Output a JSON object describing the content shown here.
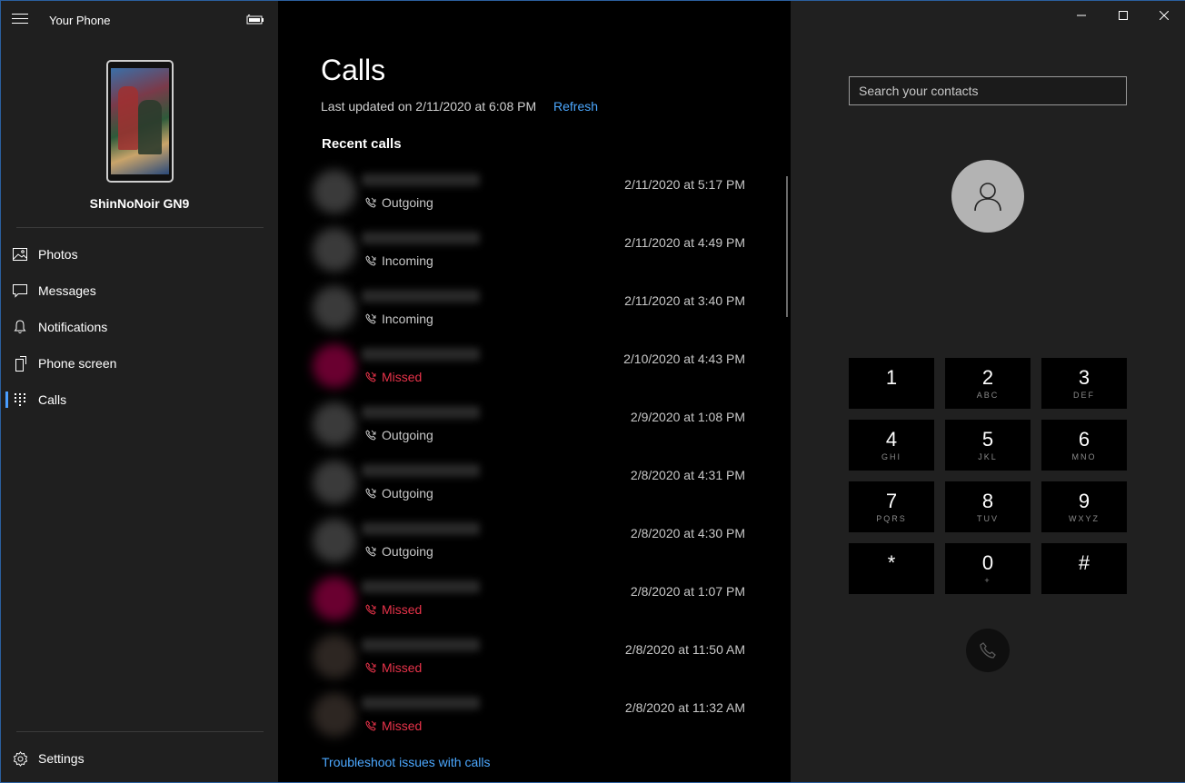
{
  "app": {
    "title": "Your Phone"
  },
  "device": {
    "name": "ShinNoNoir GN9"
  },
  "sidebar": {
    "items": [
      {
        "label": "Photos",
        "icon": "photos-icon"
      },
      {
        "label": "Messages",
        "icon": "messages-icon"
      },
      {
        "label": "Notifications",
        "icon": "bell-icon"
      },
      {
        "label": "Phone screen",
        "icon": "phone-screen-icon"
      },
      {
        "label": "Calls",
        "icon": "dialpad-icon",
        "active": true
      }
    ],
    "settings_label": "Settings"
  },
  "calls": {
    "title": "Calls",
    "last_updated": "Last updated on 2/11/2020 at 6:08 PM",
    "refresh_label": "Refresh",
    "recent_label": "Recent calls",
    "items": [
      {
        "type": "Outgoing",
        "time": "2/11/2020 at 5:17 PM"
      },
      {
        "type": "Incoming",
        "time": "2/11/2020 at 4:49 PM"
      },
      {
        "type": "Incoming",
        "time": "2/11/2020 at 3:40 PM"
      },
      {
        "type": "Missed",
        "time": "2/10/2020 at 4:43 PM"
      },
      {
        "type": "Outgoing",
        "time": "2/9/2020 at 1:08 PM"
      },
      {
        "type": "Outgoing",
        "time": "2/8/2020 at 4:31 PM"
      },
      {
        "type": "Outgoing",
        "time": "2/8/2020 at 4:30 PM"
      },
      {
        "type": "Missed",
        "time": "2/8/2020 at 1:07 PM"
      },
      {
        "type": "Missed",
        "time": "2/8/2020 at 11:50 AM"
      },
      {
        "type": "Missed",
        "time": "2/8/2020 at 11:32 AM"
      }
    ],
    "troubleshoot_label": "Troubleshoot issues with calls"
  },
  "dialer": {
    "search_placeholder": "Search your contacts",
    "keys": [
      {
        "digit": "1",
        "letters": ""
      },
      {
        "digit": "2",
        "letters": "ABC"
      },
      {
        "digit": "3",
        "letters": "DEF"
      },
      {
        "digit": "4",
        "letters": "GHI"
      },
      {
        "digit": "5",
        "letters": "JKL"
      },
      {
        "digit": "6",
        "letters": "MNO"
      },
      {
        "digit": "7",
        "letters": "PQRS"
      },
      {
        "digit": "8",
        "letters": "TUV"
      },
      {
        "digit": "9",
        "letters": "WXYZ"
      },
      {
        "digit": "*",
        "letters": ""
      },
      {
        "digit": "0",
        "letters": "+"
      },
      {
        "digit": "#",
        "letters": ""
      }
    ]
  },
  "colors": {
    "accent": "#4ca8ff",
    "missed": "#e8334a",
    "window_border": "#2b5f9e"
  }
}
